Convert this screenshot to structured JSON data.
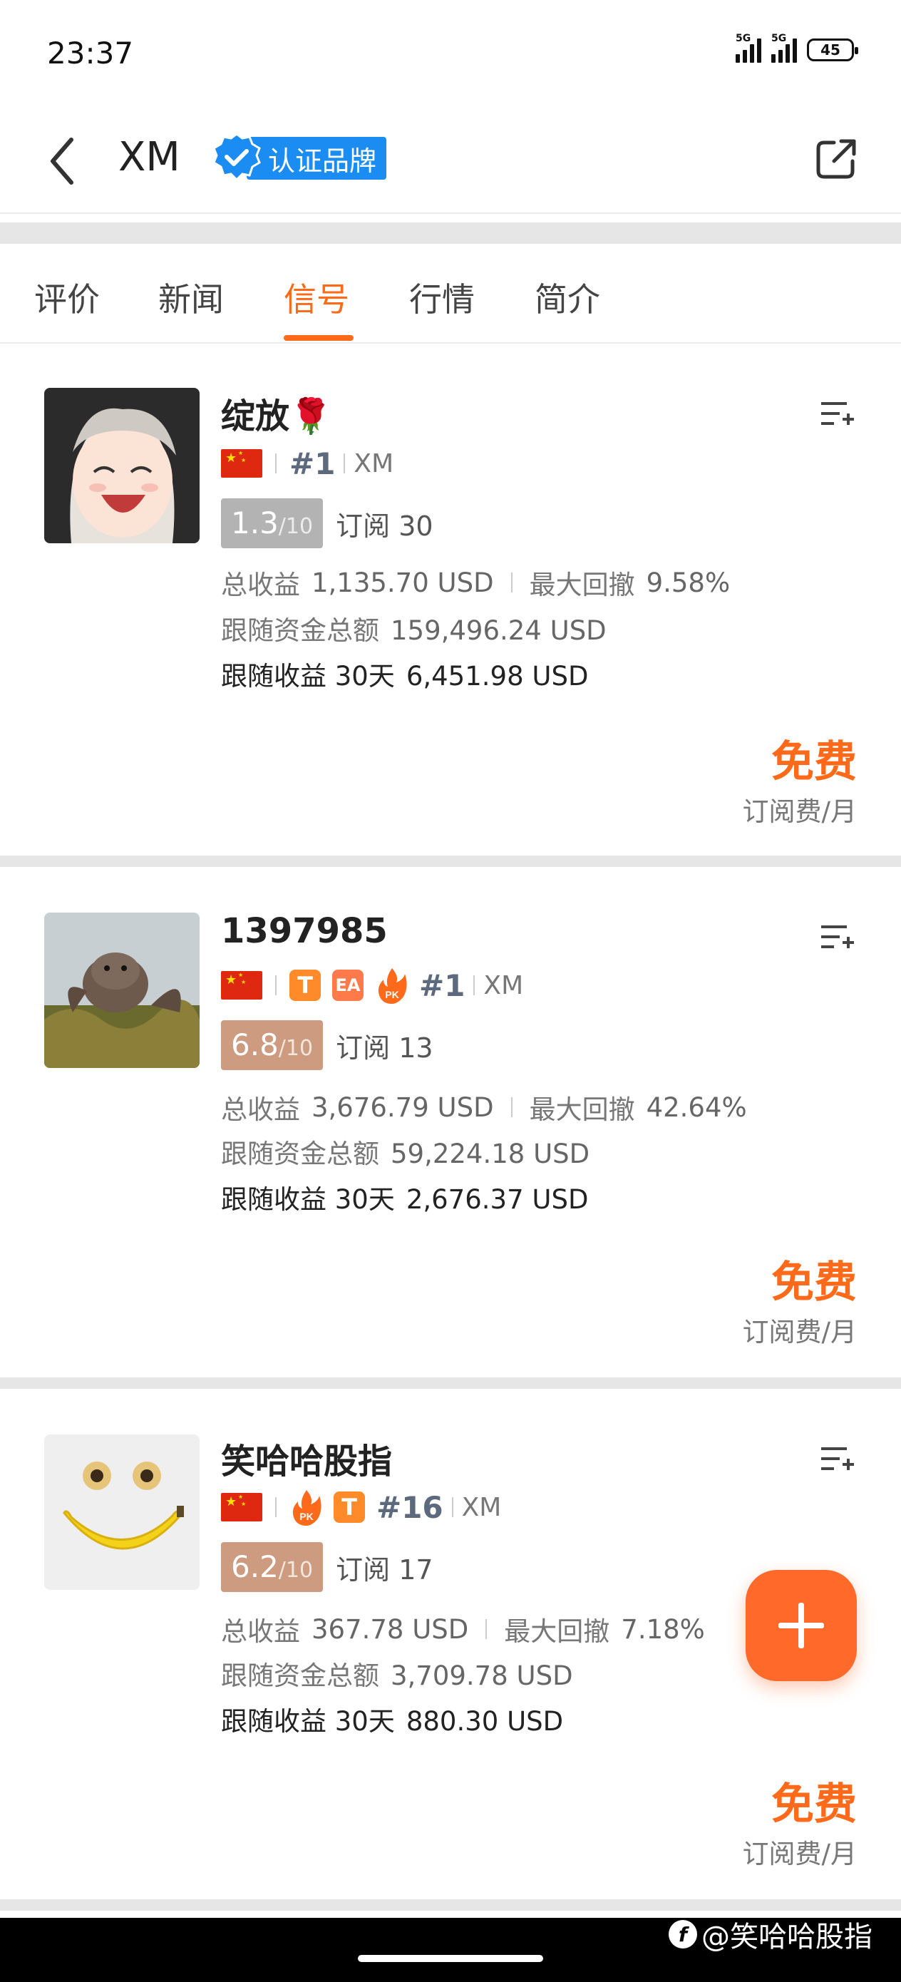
{
  "status_bar": {
    "time": "23:37",
    "signal1": "5G",
    "signal2": "5G",
    "battery": "45"
  },
  "header": {
    "title": "XM",
    "brand_badge": "认证品牌"
  },
  "tabs": [
    "评价",
    "新闻",
    "信号",
    "行情",
    "简介"
  ],
  "active_tab": 2,
  "cards": [
    {
      "name": "绽放🌹",
      "rank": "#1",
      "broker": "XM",
      "tags": [],
      "score": "1.3",
      "score_max": "/10",
      "subs_label": "订阅",
      "subs": "30",
      "total_profit_label": "总收益",
      "total_profit": "1,135.70 USD",
      "max_dd_label": "最大回撤",
      "max_dd": "9.58%",
      "follow_funds_label": "跟随资金总额",
      "follow_funds": "159,496.24 USD",
      "follow_profit_label": "跟随收益 30天",
      "follow_profit": "6,451.98 USD",
      "price": "免费",
      "price_unit": "订阅费/月"
    },
    {
      "name": "1397985",
      "rank": "#1",
      "broker": "XM",
      "tags": [
        "T",
        "EA",
        "PK"
      ],
      "score": "6.8",
      "score_max": "/10",
      "subs_label": "订阅",
      "subs": "13",
      "total_profit_label": "总收益",
      "total_profit": "3,676.79 USD",
      "max_dd_label": "最大回撤",
      "max_dd": "42.64%",
      "follow_funds_label": "跟随资金总额",
      "follow_funds": "59,224.18 USD",
      "follow_profit_label": "跟随收益 30天",
      "follow_profit": "2,676.37 USD",
      "price": "免费",
      "price_unit": "订阅费/月"
    },
    {
      "name": "笑哈哈股指",
      "rank": "#16",
      "broker": "XM",
      "tags": [
        "PK",
        "T"
      ],
      "score": "6.2",
      "score_max": "/10",
      "subs_label": "订阅",
      "subs": "17",
      "total_profit_label": "总收益",
      "total_profit": "367.78 USD",
      "max_dd_label": "最大回撤",
      "max_dd": "7.18%",
      "follow_funds_label": "跟随资金总额",
      "follow_funds": "3,709.78 USD",
      "follow_profit_label": "跟随收益 30天",
      "follow_profit": "880.30 USD",
      "price": "免费",
      "price_unit": "订阅费/月"
    }
  ],
  "watermark": "@笑哈哈股指",
  "icons": {
    "back": "chevron-left-icon",
    "brand": "verified-shield-icon",
    "share": "share-icon",
    "list_add": "playlist-add-icon",
    "fab": "plus-icon",
    "flag": "china-flag-icon",
    "pk": "pk-fire-icon"
  },
  "colors": {
    "accent": "#ff6a1a",
    "brand_blue": "#1b8cf2",
    "score_gray": "#b3b3b3",
    "score_brown": "#cc9b80"
  }
}
